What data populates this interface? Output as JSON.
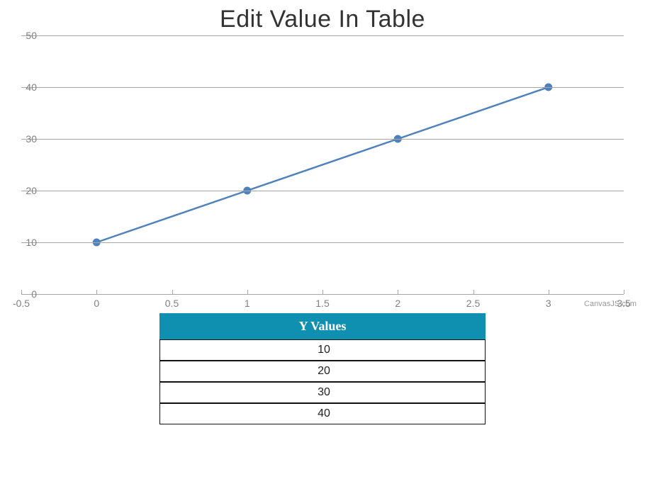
{
  "chart_data": {
    "type": "line",
    "title": "Edit Value In Table",
    "x": [
      0,
      1,
      2,
      3
    ],
    "y": [
      10,
      20,
      30,
      40
    ],
    "xlim": [
      -0.5,
      3.5
    ],
    "ylim": [
      0,
      50
    ],
    "x_ticks": [
      -0.5,
      0,
      0.5,
      1,
      1.5,
      2,
      2.5,
      3,
      3.5
    ],
    "y_ticks": [
      0,
      10,
      20,
      30,
      40,
      50
    ],
    "xlabel": "",
    "ylabel": "",
    "line_color": "#4f81bc",
    "marker": "circle"
  },
  "credit": "CanvasJS.com",
  "table": {
    "header": "Y Values",
    "rows": [
      "10",
      "20",
      "30",
      "40"
    ]
  }
}
